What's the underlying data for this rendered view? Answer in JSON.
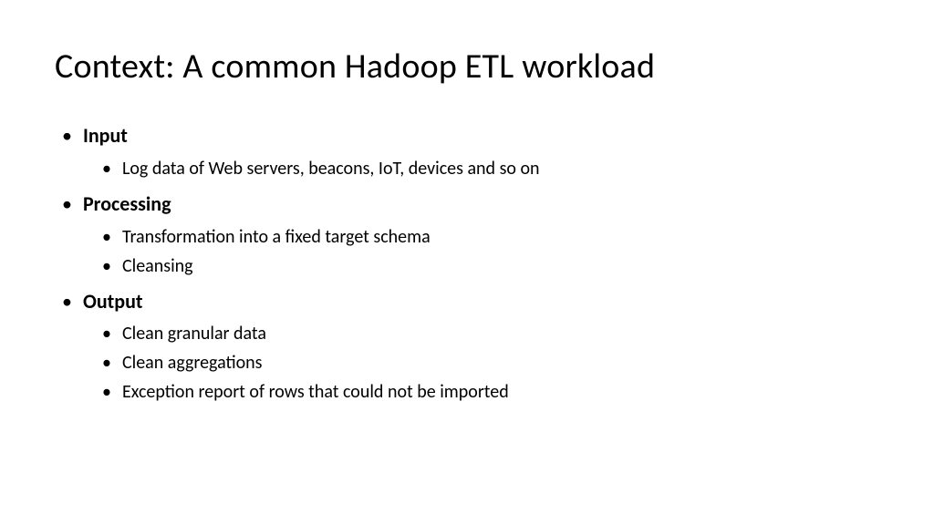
{
  "title": "Context: A common Hadoop ETL workload",
  "sections": [
    {
      "label": "Input",
      "items": [
        "Log data of Web servers, beacons, IoT, devices and so on"
      ]
    },
    {
      "label": "Processing",
      "items": [
        "Transformation into a fixed target schema",
        "Cleansing"
      ]
    },
    {
      "label": "Output",
      "items": [
        "Clean granular data",
        "Clean aggregations",
        "Exception report of rows that could not be imported"
      ]
    }
  ]
}
